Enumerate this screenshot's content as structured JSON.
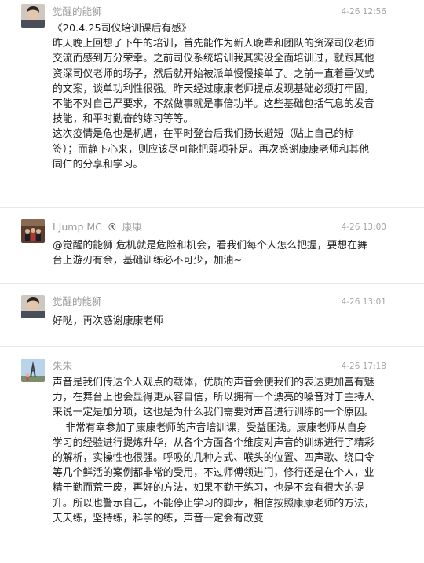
{
  "comments": [
    {
      "author": "觉醒的能狮",
      "time": "4-26 12:56",
      "text": "《20.4.25司仪培训课后有感》\n昨天晚上回想了下午的培训，首先能作为新人晚辈和团队的资深司仪老师交流而感到万分荣幸。之前司仪系统培训我其实没全面培训过，就跟其他资深司仪老师的场子，然后就开始被派单慢慢接单了。之前一直着重仪式的文案，谈单功利性很强。昨天经过康康老师提点发现基础必须打牢固，不能不对自己严要求，不然做事就是事倍功半。这些基础包括气息的发音技能，和平时勤奋的练习等等。\n这次疫情是危也是机遇，在平时登台后我们扬长避短（贴上自己的标签）；而静下心来，则应该尽可能把弱项补足。再次感谢康康老师和其他同仁的分享和学习。"
    },
    {
      "author": "I Jump MC",
      "badge": "®",
      "author_suffix": "康康",
      "time": "4-26 13:00",
      "text": "@觉醒的能狮 危机就是危险和机会，看我们每个人怎么把握，要想在舞台上游刃有余，基础训练必不可少，加油~"
    },
    {
      "author": "觉醒的能狮",
      "time": "4-26 13:01",
      "text": "好哒，再次感谢康康老师"
    },
    {
      "author": "朱朱",
      "time": "4-26 17:18",
      "text": "声音是我们传达个人观点的载体，优质的声音会使我们的表达更加富有魅力，在舞台上也会显得更从容自信，所以拥有一个漂亮的嗓音对于主持人来说一定是加分项，这也是为什么我们需要对声音进行训练的一个原因。\n    非常有幸参加了康康老师的声音培训课，受益匪浅。康康老师从自身学习的经验进行提炼升华，从各个方面各个维度对声音的训练进行了精彩的解析，实操性也很强。呼吸的几种方式、喉头的位置、四声歌、绕口令等几个鲜活的案例都非常的受用，不过师傅领进门，修行还是在个人，业精于勤而荒于废，再好的方法，如果不勤于练习，也是不会有很大的提升。所以也警示自己，不能停止学习的脚步，相信按照康康老师的方法，天天练，坚持练，科学的练，声音一定会有改变"
    }
  ]
}
